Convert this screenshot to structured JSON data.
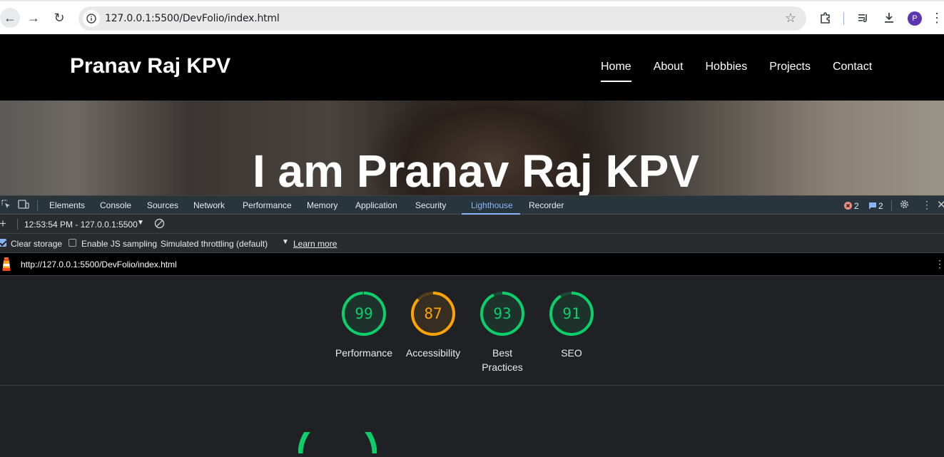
{
  "browser": {
    "url": "127.0.0.1:5500/DevFolio/index.html",
    "avatar_letter": "P"
  },
  "site": {
    "brand": "Pranav Raj KPV",
    "nav": [
      {
        "label": "Home",
        "active": true
      },
      {
        "label": "About"
      },
      {
        "label": "Hobbies"
      },
      {
        "label": "Projects"
      },
      {
        "label": "Contact"
      }
    ],
    "hero_title": "I am Pranav Raj KPV"
  },
  "devtools": {
    "tabs": [
      "Elements",
      "Console",
      "Sources",
      "Network",
      "Performance",
      "Memory",
      "Application",
      "Security",
      "Lighthouse",
      "Recorder"
    ],
    "active_tab": "Lighthouse",
    "error_count": "2",
    "issue_count": "2",
    "report_time": "12:53:54 PM - 127.0.0.1:5500",
    "clear_storage": "Clear storage",
    "enable_js_sampling": "Enable JS sampling",
    "throttling": "Simulated throttling (default)",
    "learn_more": "Learn more",
    "report_url": "http://127.0.0.1:5500/DevFolio/index.html"
  },
  "lighthouse": {
    "colors": {
      "pass": "#0cce6b",
      "average": "#ffa400"
    },
    "scores": [
      {
        "label": "Performance",
        "value": 99,
        "color": "#0cce6b"
      },
      {
        "label": "Accessibility",
        "value": 87,
        "color": "#ffa400"
      },
      {
        "label": "Best Practices",
        "value": 93,
        "color": "#0cce6b"
      },
      {
        "label": "SEO",
        "value": 91,
        "color": "#0cce6b"
      }
    ]
  }
}
